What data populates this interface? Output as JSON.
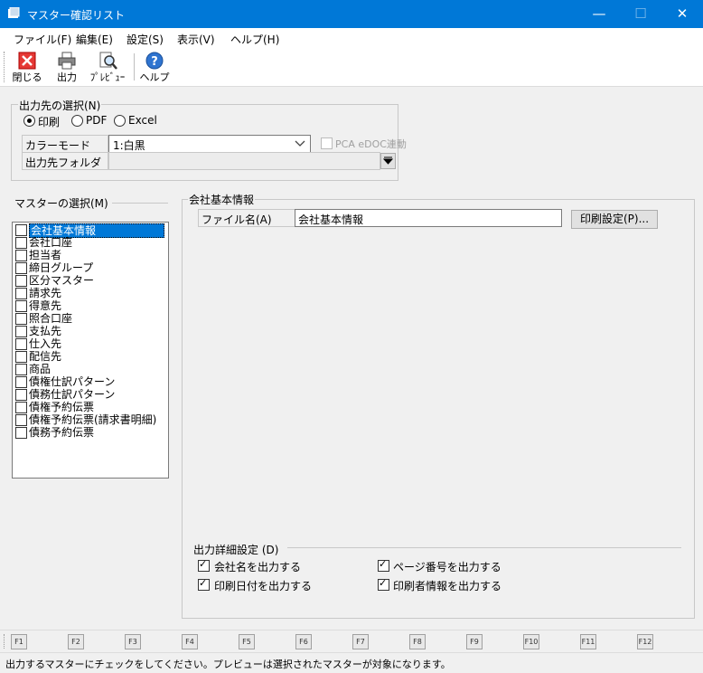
{
  "window": {
    "title": "マスター確認リスト",
    "minimize": "—",
    "maximize": "☐",
    "close": "✕"
  },
  "menu": [
    "ファイル(F)",
    "編集(E)",
    "設定(S)",
    "表示(V)",
    "ヘルプ(H)"
  ],
  "toolbar": {
    "close": "閉じる",
    "output": "出力",
    "preview": "ﾌﾟﾚﾋﾞｭｰ",
    "help": "ヘルプ"
  },
  "output_dest": {
    "title": "出力先の選択(N)",
    "options": [
      "印刷",
      "PDF",
      "Excel"
    ],
    "selected": "印刷",
    "color_mode_label": "カラーモード",
    "color_mode_value": "1:白黒",
    "pca_label": "PCA eDOC連動",
    "folder_label": "出力先フォルダ",
    "folder_value": ""
  },
  "master_select": {
    "title": "マスターの選択(M)",
    "items": [
      "会社基本情報",
      "会社口座",
      "担当者",
      "締日グループ",
      "区分マスター",
      "請求先",
      "得意先",
      "照合口座",
      "支払先",
      "仕入先",
      "配信先",
      "商品",
      "債権仕訳パターン",
      "債務仕訳パターン",
      "債権予約伝票",
      "債権予約伝票(請求書明細)",
      "債務予約伝票"
    ],
    "selected_index": 0
  },
  "company_info": {
    "title": "会社基本情報",
    "file_label": "ファイル名(A)",
    "file_value": "会社基本情報",
    "print_settings": "印刷設定(P)..."
  },
  "detail": {
    "title": "出力詳細設定 (D)",
    "options": [
      {
        "label": "会社名を出力する",
        "checked": true
      },
      {
        "label": "ページ番号を出力する",
        "checked": true
      },
      {
        "label": "印刷日付を出力する",
        "checked": true
      },
      {
        "label": "印刷者情報を出力する",
        "checked": true
      }
    ]
  },
  "fkeys": [
    "F1",
    "F2",
    "F3",
    "F4",
    "F5",
    "F6",
    "F7",
    "F8",
    "F9",
    "F10",
    "F11",
    "F12"
  ],
  "status": "出力するマスターにチェックをしてください。プレビューは選択されたマスターが対象になります。"
}
